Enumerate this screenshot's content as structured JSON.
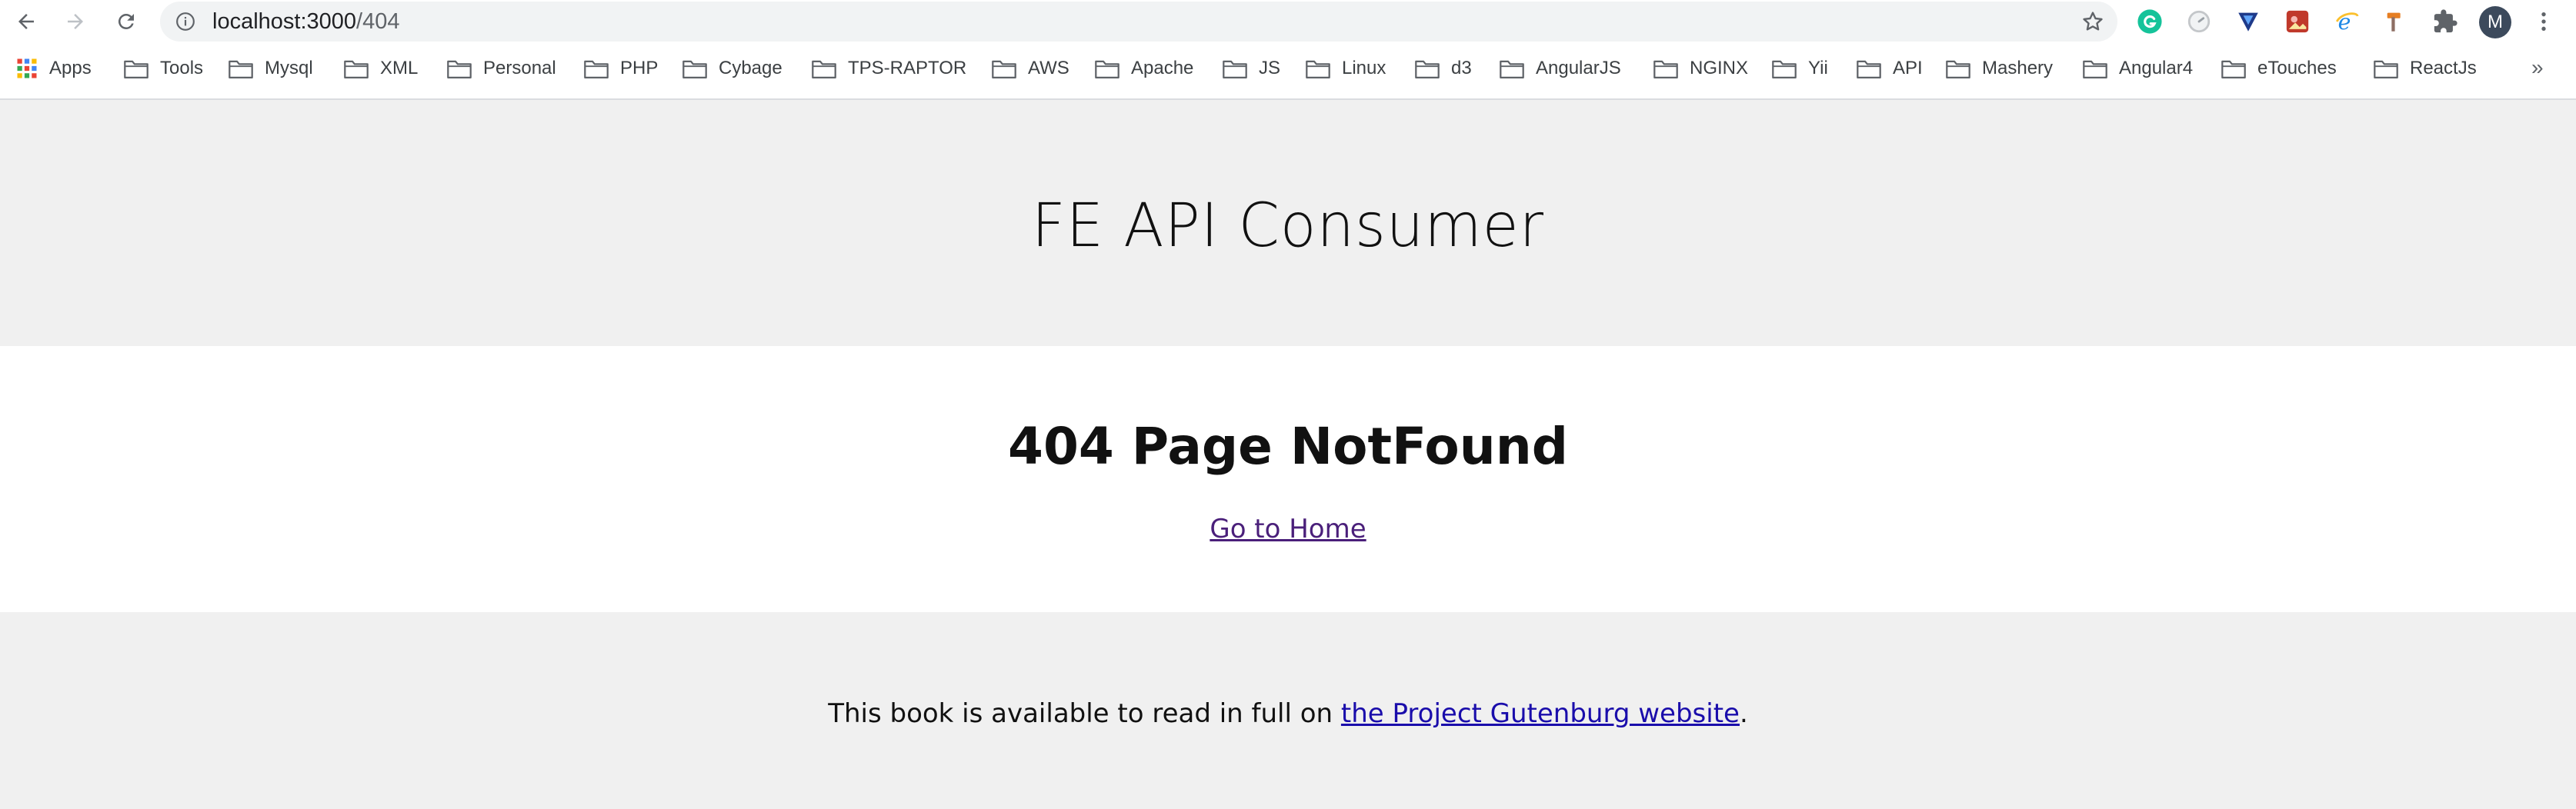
{
  "browser": {
    "url_host": "localhost:3000",
    "url_path": "/404",
    "avatar_initial": "M",
    "bookmarks_more": "»"
  },
  "bookmarks": [
    {
      "label": "Apps",
      "icon": "apps-grid-icon"
    },
    {
      "label": "Tools",
      "icon": "folder-icon"
    },
    {
      "label": "Mysql",
      "icon": "folder-icon"
    },
    {
      "label": "XML",
      "icon": "folder-icon"
    },
    {
      "label": "Personal",
      "icon": "folder-icon"
    },
    {
      "label": "PHP",
      "icon": "folder-icon"
    },
    {
      "label": "Cybage",
      "icon": "folder-icon"
    },
    {
      "label": "TPS-RAPTOR",
      "icon": "folder-icon"
    },
    {
      "label": "AWS",
      "icon": "folder-icon"
    },
    {
      "label": "Apache",
      "icon": "folder-icon"
    },
    {
      "label": "JS",
      "icon": "folder-icon"
    },
    {
      "label": "Linux",
      "icon": "folder-icon"
    },
    {
      "label": "d3",
      "icon": "folder-icon"
    },
    {
      "label": "AngularJS",
      "icon": "folder-icon"
    },
    {
      "label": "NGINX",
      "icon": "folder-icon"
    },
    {
      "label": "Yii",
      "icon": "folder-icon"
    },
    {
      "label": "API",
      "icon": "folder-icon"
    },
    {
      "label": "Mashery",
      "icon": "folder-icon"
    },
    {
      "label": "Angular4",
      "icon": "folder-icon"
    },
    {
      "label": "eTouches",
      "icon": "folder-icon"
    },
    {
      "label": "ReactJs",
      "icon": "folder-icon"
    }
  ],
  "page": {
    "site_title": "FE API Consumer",
    "error_heading": "404 Page NotFound",
    "home_link": "Go to Home",
    "footer_prefix": "This book is available to read in full on ",
    "footer_link": "the Project Gutenburg website",
    "footer_suffix": "."
  },
  "colors": {
    "band_bg": "#f0f0f0",
    "visited_link": "#4a1f7a",
    "link": "#1a0dab"
  }
}
